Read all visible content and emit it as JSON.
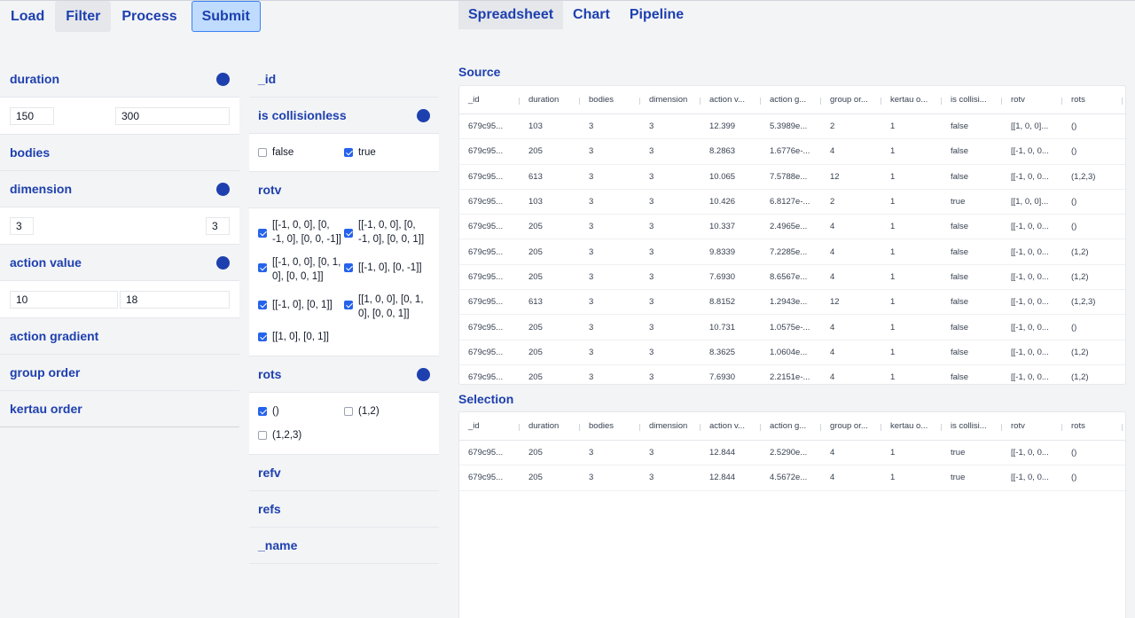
{
  "nav": {
    "items": [
      "Load",
      "Filter",
      "Process",
      "Submit"
    ]
  },
  "view_tabs": [
    "Spreadsheet",
    "Chart",
    "Pipeline"
  ],
  "filters_left": {
    "duration": {
      "label": "duration",
      "min": "150",
      "max": "300"
    },
    "bodies": {
      "label": "bodies"
    },
    "dimension": {
      "label": "dimension",
      "min": "3",
      "max": "3"
    },
    "action_value": {
      "label": "action value",
      "min": "10",
      "max": "18"
    },
    "action_gradient": {
      "label": "action gradient"
    },
    "group_order": {
      "label": "group order"
    },
    "kertau_order": {
      "label": "kertau order"
    }
  },
  "filters_right": {
    "id": {
      "label": "_id"
    },
    "is_collisionless": {
      "label": "is collisionless",
      "options": [
        {
          "label": "false",
          "checked": false
        },
        {
          "label": "true",
          "checked": true
        }
      ]
    },
    "rotv": {
      "label": "rotv",
      "options": [
        {
          "label": "[[-1, 0, 0], [0, -1, 0], [0, 0, -1]]",
          "checked": true
        },
        {
          "label": "[[-1, 0, 0], [0, -1, 0], [0, 0, 1]]",
          "checked": true
        },
        {
          "label": "[[-1, 0, 0], [0, 1, 0], [0, 0, 1]]",
          "checked": true
        },
        {
          "label": "[[-1, 0], [0, -1]]",
          "checked": true
        },
        {
          "label": "[[-1, 0], [0, 1]]",
          "checked": true
        },
        {
          "label": "[[1, 0, 0], [0, 1, 0], [0, 0, 1]]",
          "checked": true
        },
        {
          "label": "[[1, 0], [0, 1]]",
          "checked": true
        }
      ]
    },
    "rots": {
      "label": "rots",
      "options": [
        {
          "label": "()",
          "checked": true
        },
        {
          "label": "(1,2)",
          "checked": false
        },
        {
          "label": "(1,2,3)",
          "checked": false
        }
      ]
    },
    "refv": {
      "label": "refv"
    },
    "refs": {
      "label": "refs"
    },
    "name": {
      "label": "_name"
    }
  },
  "source": {
    "title": "Source",
    "columns": [
      "_id",
      "duration",
      "bodies",
      "dimension",
      "action v...",
      "action g...",
      "group or...",
      "kertau o...",
      "is collisi...",
      "rotv",
      "rots"
    ],
    "rows": [
      [
        "679c95...",
        "103",
        "3",
        "3",
        "12.399",
        "5.3989e...",
        "2",
        "1",
        "false",
        "[[1, 0, 0]...",
        "()"
      ],
      [
        "679c95...",
        "205",
        "3",
        "3",
        "8.2863",
        "1.6776e-...",
        "4",
        "1",
        "false",
        "[[-1, 0, 0...",
        "()"
      ],
      [
        "679c95...",
        "613",
        "3",
        "3",
        "10.065",
        "7.5788e...",
        "12",
        "1",
        "false",
        "[[-1, 0, 0...",
        "(1,2,3)"
      ],
      [
        "679c95...",
        "103",
        "3",
        "3",
        "10.426",
        "6.8127e-...",
        "2",
        "1",
        "true",
        "[[1, 0, 0]...",
        "()"
      ],
      [
        "679c95...",
        "205",
        "3",
        "3",
        "10.337",
        "2.4965e...",
        "4",
        "1",
        "false",
        "[[-1, 0, 0...",
        "()"
      ],
      [
        "679c95...",
        "205",
        "3",
        "3",
        "9.8339",
        "7.2285e...",
        "4",
        "1",
        "false",
        "[[-1, 0, 0...",
        "(1,2)"
      ],
      [
        "679c95...",
        "205",
        "3",
        "3",
        "7.6930",
        "8.6567e...",
        "4",
        "1",
        "false",
        "[[-1, 0, 0...",
        "(1,2)"
      ],
      [
        "679c95...",
        "613",
        "3",
        "3",
        "8.8152",
        "1.2943e...",
        "12",
        "1",
        "false",
        "[[-1, 0, 0...",
        "(1,2,3)"
      ],
      [
        "679c95...",
        "205",
        "3",
        "3",
        "10.731",
        "1.0575e-...",
        "4",
        "1",
        "false",
        "[[-1, 0, 0...",
        "()"
      ],
      [
        "679c95...",
        "205",
        "3",
        "3",
        "8.3625",
        "1.0604e...",
        "4",
        "1",
        "false",
        "[[-1, 0, 0...",
        "(1,2)"
      ],
      [
        "679c95...",
        "205",
        "3",
        "3",
        "7.6930",
        "2.2151e-...",
        "4",
        "1",
        "false",
        "[[-1, 0, 0...",
        "(1,2)"
      ]
    ]
  },
  "selection": {
    "title": "Selection",
    "columns": [
      "_id",
      "duration",
      "bodies",
      "dimension",
      "action v...",
      "action g...",
      "group or...",
      "kertau o...",
      "is collisi...",
      "rotv",
      "rots"
    ],
    "rows": [
      [
        "679c95...",
        "205",
        "3",
        "3",
        "12.844",
        "2.5290e...",
        "4",
        "1",
        "true",
        "[[-1, 0, 0...",
        "()"
      ],
      [
        "679c95...",
        "205",
        "3",
        "3",
        "12.844",
        "4.5672e...",
        "4",
        "1",
        "true",
        "[[-1, 0, 0...",
        "()"
      ]
    ]
  }
}
